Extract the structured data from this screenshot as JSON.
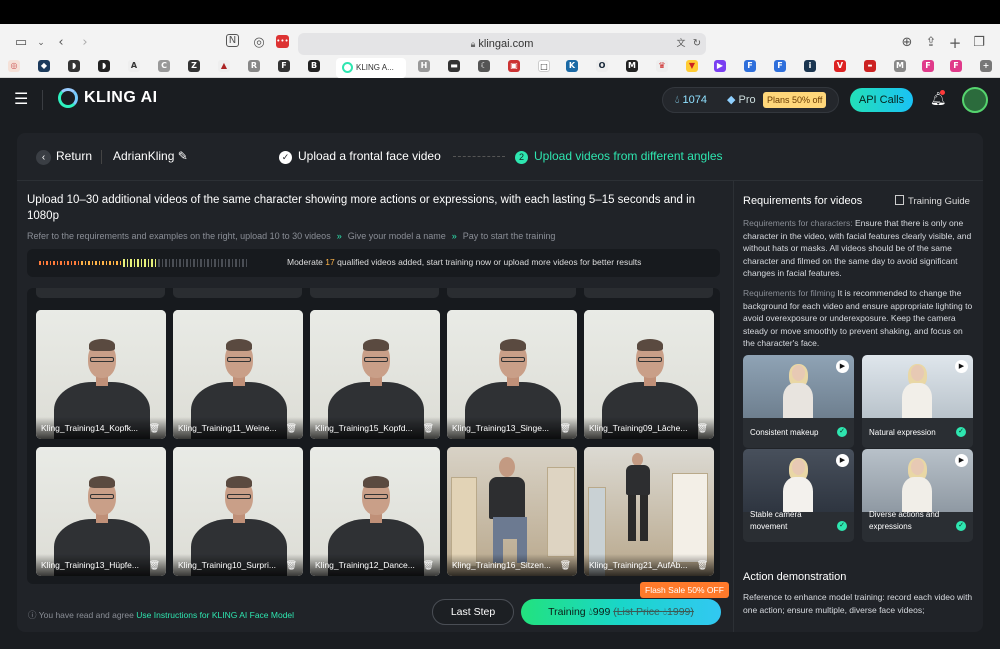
{
  "browser": {
    "url": "klingai.com",
    "active_tab": "KLING A..."
  },
  "header": {
    "logo_text": "KLING AI",
    "credits": "1074",
    "plan": "Pro",
    "plans_badge": "Plans 50% off",
    "api_calls": "API Calls"
  },
  "stepbar": {
    "return_label": "Return",
    "model_name": "AdrianKling",
    "step1": "Upload a frontal face video",
    "step2_num": "2",
    "step2": "Upload videos from different angles"
  },
  "main": {
    "title": "Upload 10–30 additional videos of the same character showing more actions or expressions, with each lasting 5–15 seconds and in 1080p",
    "substep1": "Refer to the requirements and examples on the right, upload 10 to 30 videos",
    "substep2": "Give your model a name",
    "substep3": "Pay to start the training",
    "progress_prefix": "Moderate",
    "progress_count": "17",
    "progress_suffix": "qualified videos added, start training now or upload more videos for better results",
    "videos": [
      {
        "name": "Kling_Training14_Kopfk..."
      },
      {
        "name": "Kling_Training11_Weine..."
      },
      {
        "name": "Kling_Training15_Kopfd..."
      },
      {
        "name": "Kling_Training13_Singe..."
      },
      {
        "name": "Kling_Training09_Lâche..."
      },
      {
        "name": "Kling_Training13_Hüpfe..."
      },
      {
        "name": "Kling_Training10_Surpri..."
      },
      {
        "name": "Kling_Training12_Dance..."
      },
      {
        "name": "Kling_Training16_Sitzen..."
      },
      {
        "name": "Kling_Training21_AufAb..."
      }
    ]
  },
  "footer": {
    "agree_text": "You have read and agree",
    "agree_link": "Use Instructions for KLING AI Face Model",
    "last_step": "Last Step",
    "train_label": "Training",
    "train_price": "999",
    "list_price_label": "(List Price",
    "list_price": "1999)",
    "flash_sale": "Flash Sale 50% OFF"
  },
  "requirements": {
    "title": "Requirements for videos",
    "guide": "Training Guide",
    "char_label": "Requirements for characters:",
    "char_text": "Ensure that there is only one character in the video, with facial features clearly visible, and without hats or masks. All videos should be of the same character and filmed on the same day to avoid significant changes in facial features.",
    "film_label": "Requirements for filming",
    "film_text": "It is recommended to change the background for each video and ensure appropriate lighting to avoid overexposure or underexposure. Keep the camera steady or move smoothly to prevent shaking, and focus on the character's face.",
    "cards": [
      {
        "label": "Consistent makeup"
      },
      {
        "label": "Natural expression"
      },
      {
        "label": "Stable camera movement"
      },
      {
        "label": "Diverse actions and expressions"
      }
    ],
    "action_title": "Action demonstration",
    "action_text": "Reference to enhance model training: record each video with one action; ensure multiple, diverse face videos;"
  },
  "colors": {
    "accent": "#2ee6b0",
    "panel": "#202328",
    "background": "#1a1d21"
  }
}
